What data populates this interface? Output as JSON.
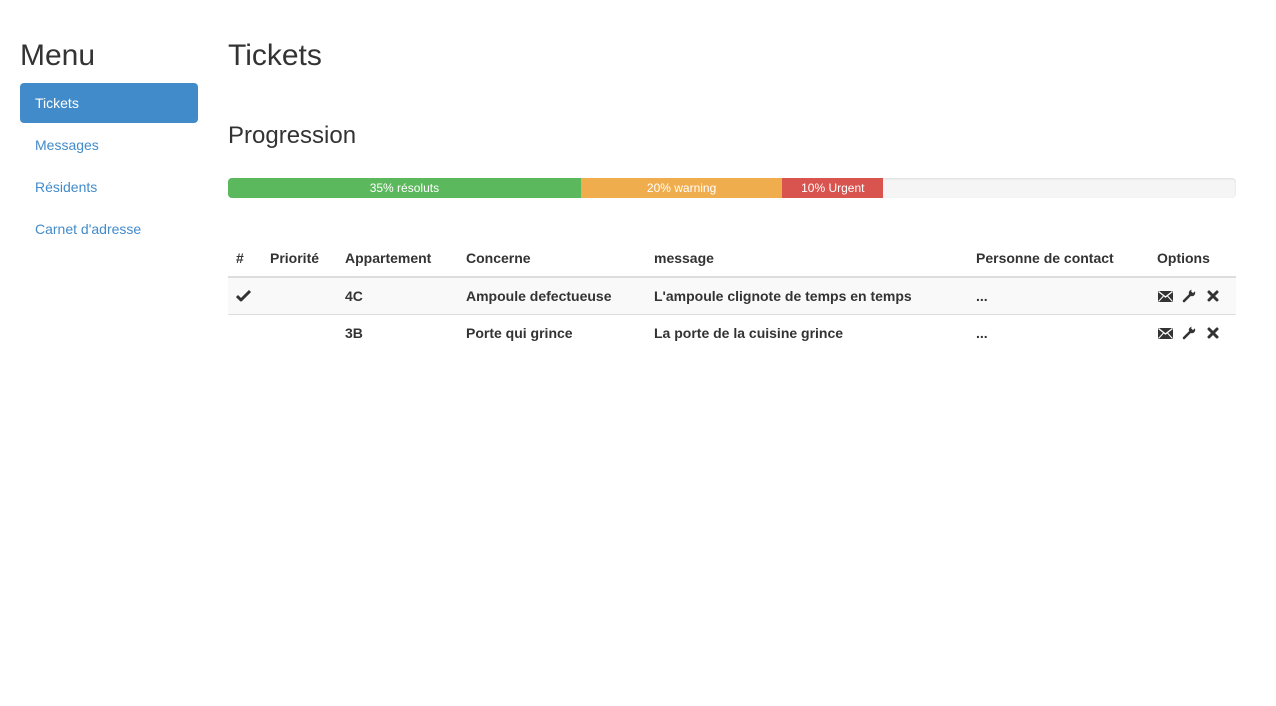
{
  "sidebar": {
    "title": "Menu",
    "items": [
      {
        "label": "Tickets",
        "active": true
      },
      {
        "label": "Messages",
        "active": false
      },
      {
        "label": "Résidents",
        "active": false
      },
      {
        "label": "Carnet d'adresse",
        "active": false
      }
    ]
  },
  "main": {
    "title": "Tickets",
    "section_title": "Progression",
    "progress": [
      {
        "label": "35% résoluts",
        "value": 35,
        "color": "#5cb85c"
      },
      {
        "label": "20% warning",
        "value": 20,
        "color": "#f0ad4e"
      },
      {
        "label": "10% Urgent",
        "value": 10,
        "color": "#d9534f"
      }
    ],
    "table": {
      "columns": [
        "#",
        "Priorité",
        "Appartement",
        "Concerne",
        "message",
        "Personne de contact",
        "Options"
      ],
      "rows": [
        {
          "status_icon": "check-icon",
          "priorite": "",
          "appartement": "4C",
          "concerne": "Ampoule defectueuse",
          "message": "L'ampoule clignote de temps en temps",
          "contact": "...",
          "options": [
            "envelope-icon",
            "wrench-icon",
            "remove-icon"
          ]
        },
        {
          "status_icon": "",
          "priorite": "",
          "appartement": "3B",
          "concerne": "Porte qui grince",
          "message": "La porte de la cuisine grince",
          "contact": "...",
          "options": [
            "envelope-icon",
            "wrench-icon",
            "remove-icon"
          ]
        }
      ]
    }
  }
}
